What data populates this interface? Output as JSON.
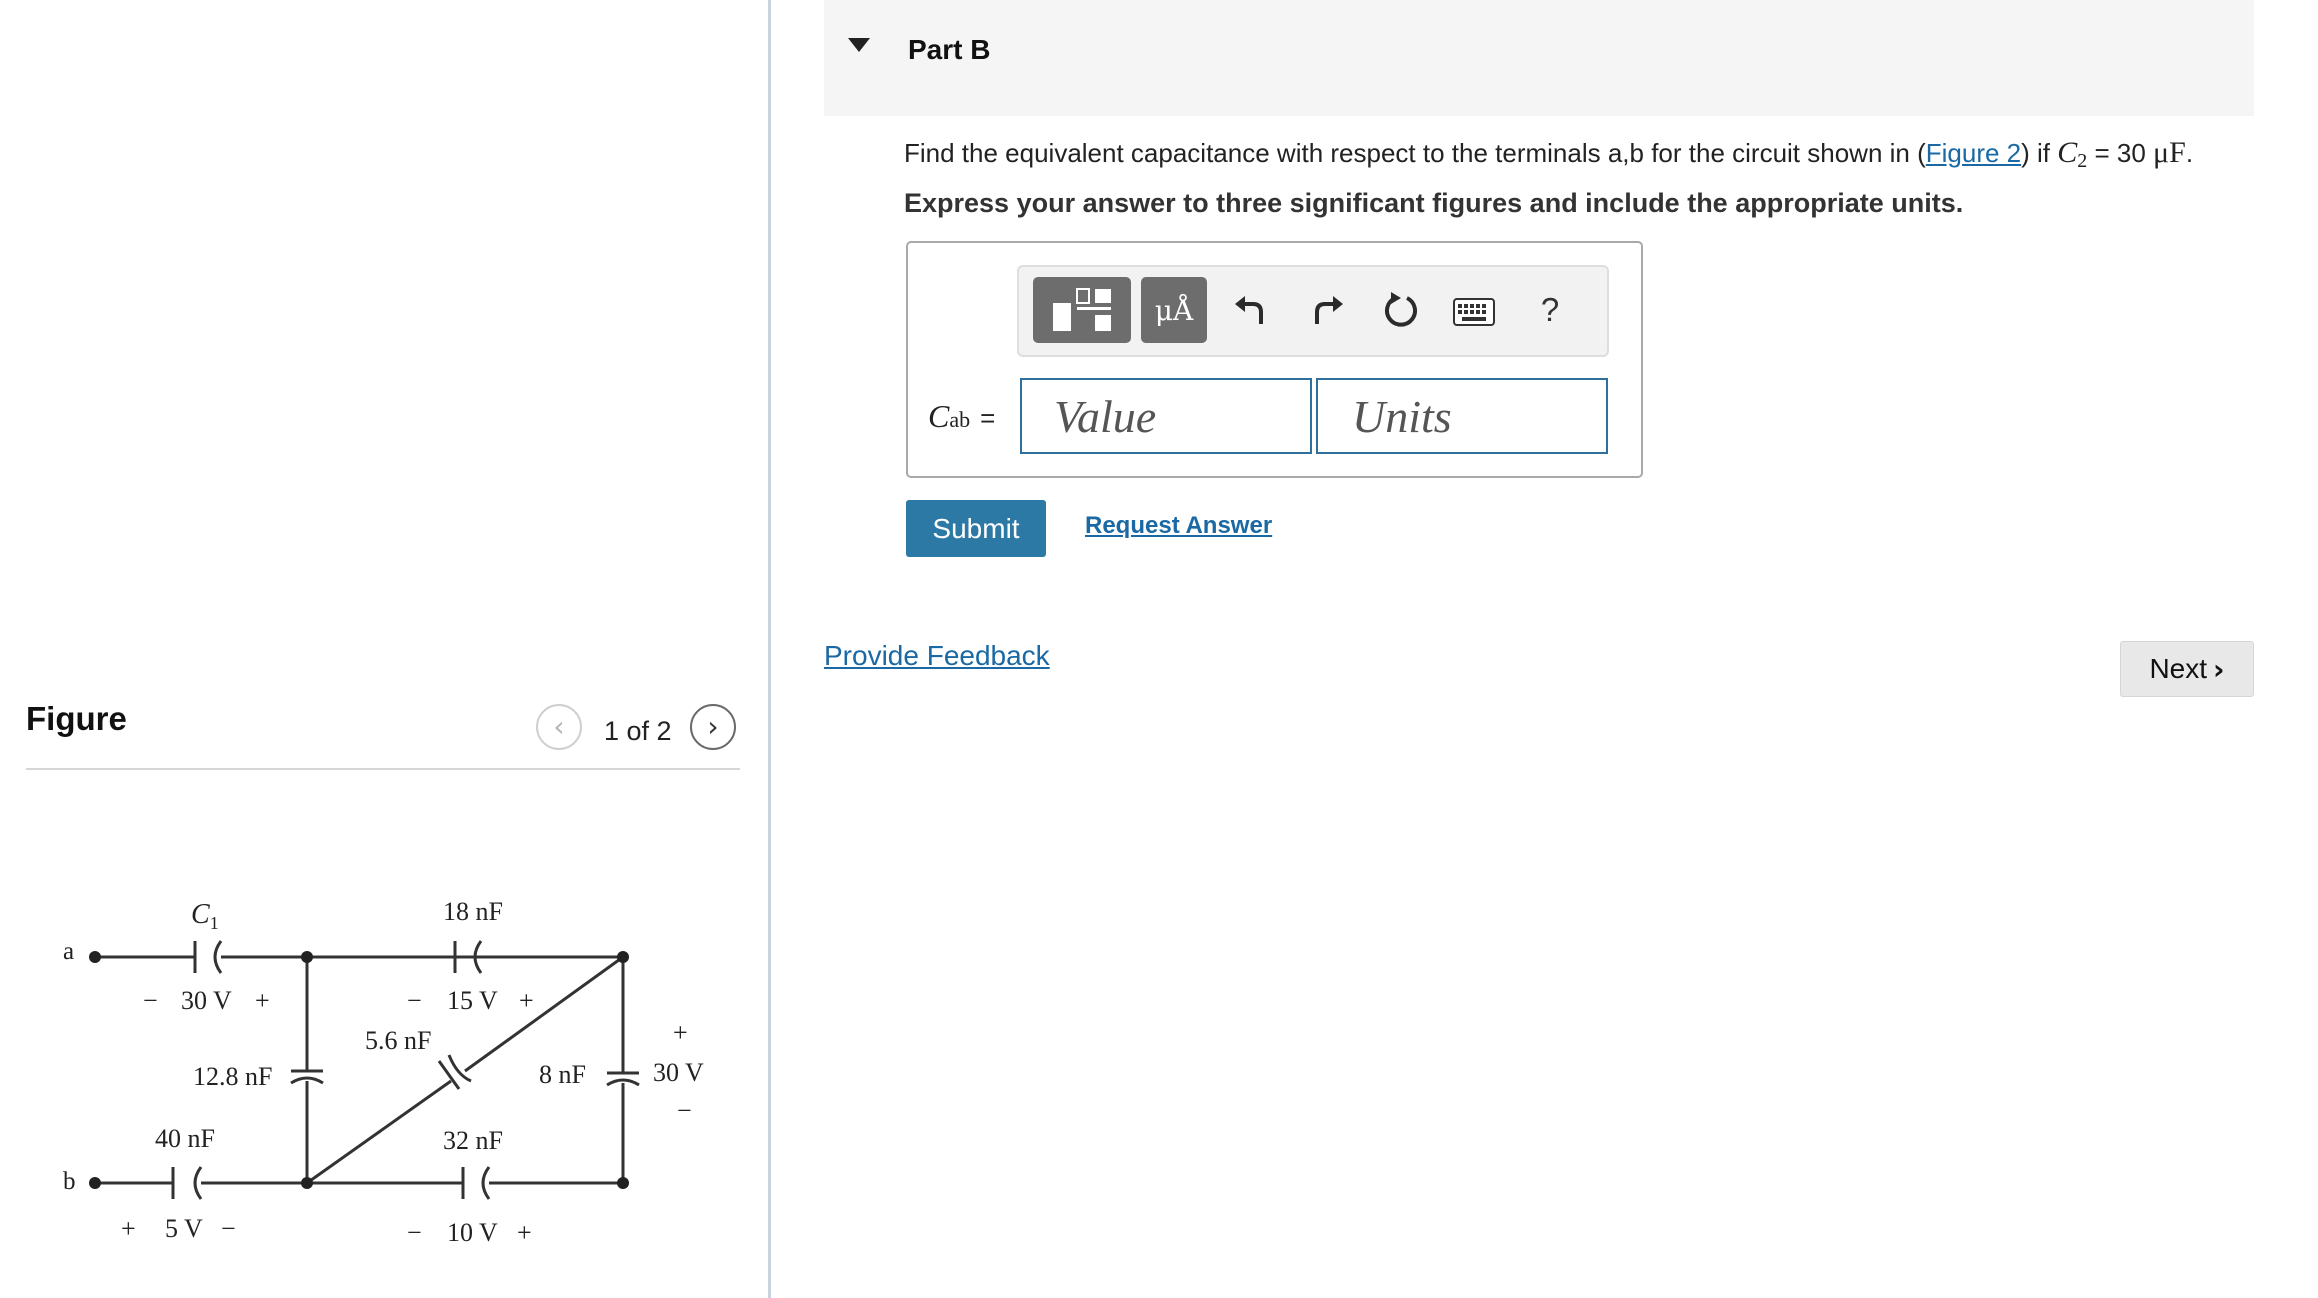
{
  "figure": {
    "title": "Figure",
    "counter": "1 of 2",
    "prev_icon": "‹",
    "next_icon": "›",
    "circuit": {
      "c1_label": "C",
      "c1_sub": "1",
      "v_30": "30 V",
      "c_18": "18 nF",
      "v_15": "15 V",
      "c_5_6": "5.6 nF",
      "c_12_8": "12.8 nF",
      "c_8": "8 nF",
      "v_30_right": "30 V",
      "c_40": "40 nF",
      "v_5": "5 V",
      "c_32": "32 nF",
      "v_10": "10 V",
      "terminal_a": "a",
      "terminal_b": "b",
      "plus": "+",
      "minus": "−"
    }
  },
  "part": {
    "title": "Part B",
    "question": {
      "prefix": "Find the equivalent capacitance with respect to the terminals a,b for the circuit shown in (",
      "link": "Figure 2",
      "middle": ") if ",
      "var": "C",
      "var_sub": "2",
      "suffix": " = 30 ",
      "unit": "μF",
      "end": "."
    },
    "instruction": "Express your answer to three significant figures and include the appropriate units."
  },
  "toolbar": {
    "units_label": "μÅ",
    "help_label": "?"
  },
  "answer": {
    "label": "C",
    "label_sub": "ab",
    "equals": "=",
    "value_placeholder": "Value",
    "units_placeholder": "Units"
  },
  "actions": {
    "submit": "Submit",
    "request_answer": "Request Answer",
    "provide_feedback": "Provide Feedback",
    "next": "Next",
    "next_icon": "›"
  }
}
